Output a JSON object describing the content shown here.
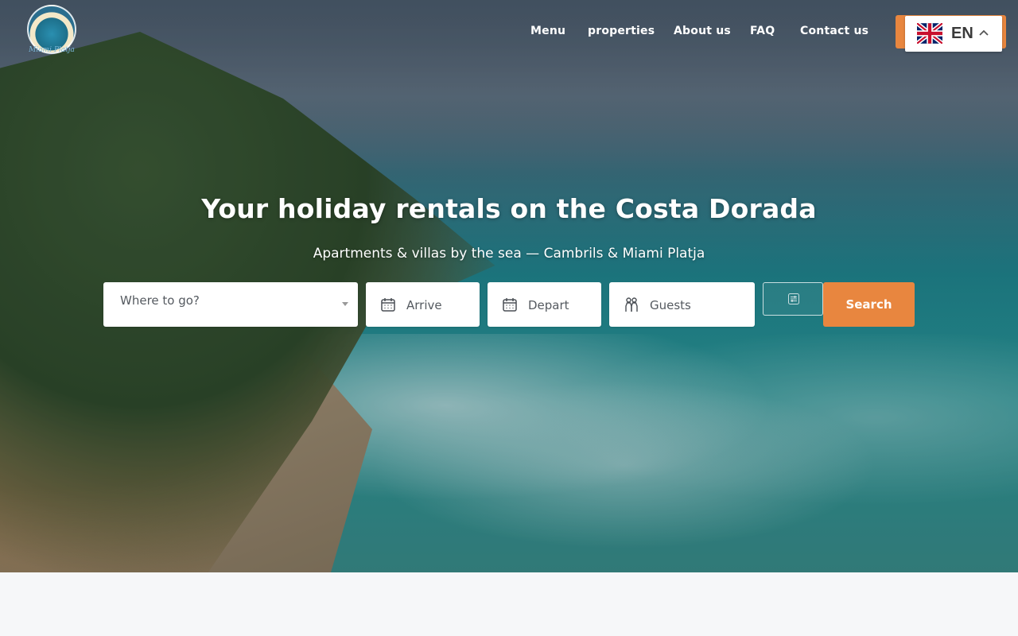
{
  "header": {
    "logo_script": "Miami Platja",
    "nav": [
      {
        "label": "Menu"
      },
      {
        "label": "properties"
      },
      {
        "label": "About us"
      },
      {
        "label": "FAQ"
      },
      {
        "label": "Contact us"
      }
    ],
    "language": {
      "code": "EN",
      "flag": "uk-flag-icon"
    }
  },
  "hero": {
    "title": "Your holiday rentals on the Costa Dorada",
    "subtitle": "Apartments & villas by the sea — Cambrils & Miami Platja"
  },
  "search": {
    "destination_placeholder": "Where to go?",
    "arrive_placeholder": "Arrive",
    "depart_placeholder": "Depart",
    "guests_placeholder": "Guests",
    "filter_icon": "sliders-icon",
    "search_label": "Search"
  },
  "colors": {
    "accent": "#e8863f",
    "text_on_hero": "#ffffff"
  }
}
